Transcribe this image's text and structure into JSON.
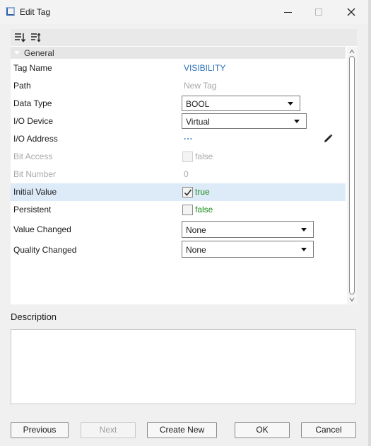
{
  "window": {
    "title": "Edit Tag"
  },
  "toolbar": {
    "icons": [
      "sort-categorized-icon",
      "sort-alphabetical-icon"
    ]
  },
  "section": {
    "title": "General"
  },
  "properties": [
    {
      "label": "Tag Name",
      "value": "VISIBILITY",
      "kind": "text-blue"
    },
    {
      "label": "Path",
      "value": "New Tag",
      "kind": "text-grey"
    },
    {
      "label": "Data Type",
      "value": "BOOL",
      "kind": "dropdown"
    },
    {
      "label": "I/O Device",
      "value": "Virtual",
      "kind": "dropdown"
    },
    {
      "label": "I/O Address",
      "value": "...",
      "kind": "ellipsis"
    },
    {
      "label": "Bit Access",
      "value": "false",
      "kind": "checkbox-disabled",
      "checked": false
    },
    {
      "label": "Bit Number",
      "value": "0",
      "kind": "text-grey"
    },
    {
      "label": "Initial Value",
      "value": "true",
      "kind": "checkbox",
      "checked": true
    },
    {
      "label": "Persistent",
      "value": "false",
      "kind": "checkbox",
      "checked": false
    },
    {
      "label": "Value Changed",
      "value": "None",
      "kind": "dropdown"
    },
    {
      "label": "Quality Changed",
      "value": "None",
      "kind": "dropdown"
    }
  ],
  "description": {
    "label": "Description",
    "value": ""
  },
  "buttons": {
    "previous": "Previous",
    "next": "Next",
    "create_new": "Create New",
    "ok": "OK",
    "cancel": "Cancel"
  },
  "colors": {
    "selected_row": "#ddeaf8",
    "value_blue": "#2a70b8",
    "value_green": "#1e8a1e",
    "disabled_text": "#a8a8a8"
  }
}
